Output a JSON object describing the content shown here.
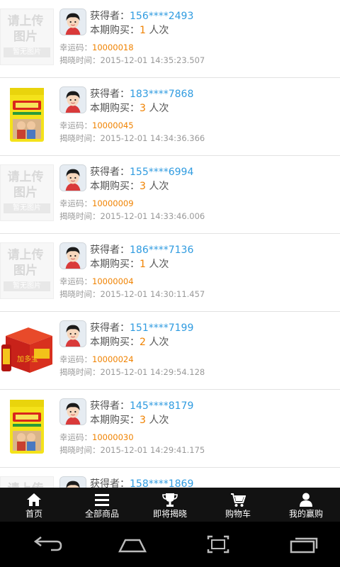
{
  "labels": {
    "winner": "获得者：",
    "period_buy": "本期购买：",
    "times_unit": "人次",
    "lucky_code": "幸运码：",
    "reveal_time": "揭晓时间："
  },
  "placeholder": {
    "line1": "请上传",
    "line2": "图片",
    "badge": "暂无图片"
  },
  "items": [
    {
      "image": "placeholder",
      "phone": "156****2493",
      "count": "1",
      "code": "10000018",
      "time": "2015-12-01 14:35:23.507"
    },
    {
      "image": "rice-bag",
      "phone": "183****7868",
      "count": "3",
      "code": "10000045",
      "time": "2015-12-01 14:34:36.366"
    },
    {
      "image": "placeholder",
      "phone": "155****6994",
      "count": "3",
      "code": "10000009",
      "time": "2015-12-01 14:33:46.006"
    },
    {
      "image": "placeholder",
      "phone": "186****7136",
      "count": "1",
      "code": "10000004",
      "time": "2015-12-01 14:30:11.457"
    },
    {
      "image": "drink-box",
      "phone": "151****7199",
      "count": "2",
      "code": "10000024",
      "time": "2015-12-01 14:29:54.128"
    },
    {
      "image": "rice-bag",
      "phone": "145****8179",
      "count": "3",
      "code": "10000030",
      "time": "2015-12-01 14:29:41.175"
    },
    {
      "image": "placeholder",
      "phone": "158****1869",
      "count": "",
      "code": "",
      "time": ""
    }
  ],
  "tabs": [
    {
      "label": "首页",
      "icon": "home-icon"
    },
    {
      "label": "全部商品",
      "icon": "list-icon"
    },
    {
      "label": "即将揭晓",
      "icon": "trophy-icon"
    },
    {
      "label": "购物车",
      "icon": "cart-icon"
    },
    {
      "label": "我的赢购",
      "icon": "user-icon"
    }
  ],
  "colors": {
    "phone": "#2f9be0",
    "count": "#f08200",
    "code": "#f08200",
    "tabbar_bg": "#121212"
  }
}
